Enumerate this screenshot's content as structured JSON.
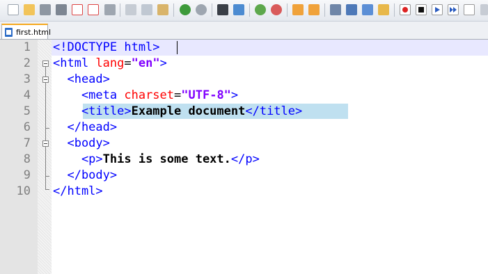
{
  "tabs": [
    {
      "label": "first.html"
    }
  ],
  "editor": {
    "line_numbers": [
      "1",
      "2",
      "3",
      "4",
      "5",
      "6",
      "7",
      "8",
      "9",
      "10"
    ],
    "lines": [
      [
        {
          "t": "tag",
          "v": "<!DOCTYPE html>"
        }
      ],
      [
        {
          "t": "tag",
          "v": "<html "
        },
        {
          "t": "attr",
          "v": "lang"
        },
        {
          "t": "eq",
          "v": "="
        },
        {
          "t": "val",
          "v": "\"en\""
        },
        {
          "t": "tag",
          "v": ">"
        }
      ],
      [
        {
          "t": "tag",
          "v": "  <head>"
        }
      ],
      [
        {
          "t": "tag",
          "v": "    <meta "
        },
        {
          "t": "attr",
          "v": "charset"
        },
        {
          "t": "eq",
          "v": "="
        },
        {
          "t": "val",
          "v": "\"UTF-8\""
        },
        {
          "t": "tag",
          "v": ">"
        }
      ],
      [
        {
          "t": "tag",
          "v": "    <title>"
        },
        {
          "t": "txt",
          "v": "Example document"
        },
        {
          "t": "tag",
          "v": "</title>"
        }
      ],
      [
        {
          "t": "tag",
          "v": "  </head>"
        }
      ],
      [
        {
          "t": "tag",
          "v": "  <body>"
        }
      ],
      [
        {
          "t": "tag",
          "v": "    <p>"
        },
        {
          "t": "txt",
          "v": "This is some text."
        },
        {
          "t": "tag",
          "v": "</p>"
        }
      ],
      [
        {
          "t": "tag",
          "v": "  </body>"
        }
      ],
      [
        {
          "t": "tag",
          "v": "</html>"
        }
      ]
    ]
  },
  "toolbar": {
    "icons": [
      "new-file-icon",
      "open-file-icon",
      "save-icon",
      "save-all-icon",
      "close-icon",
      "close-all-icon",
      "print-icon",
      "cut-icon",
      "copy-icon",
      "paste-icon",
      "undo-icon",
      "redo-icon",
      "find-icon",
      "replace-icon",
      "zoom-in-icon",
      "zoom-out-icon",
      "sync-vertical-icon",
      "sync-horizontal-icon",
      "word-wrap-icon",
      "show-all-chars-icon",
      "indent-guide-icon",
      "doc-map-icon",
      "record-macro-icon",
      "stop-macro-icon",
      "play-macro-icon",
      "run-macro-multiple-icon",
      "save-macro-icon"
    ]
  },
  "colors": {
    "tag": "#0000ff",
    "attr": "#ff0000",
    "value": "#8000ff",
    "text": "#000000",
    "selection": "#bfe0f0",
    "current_line": "#e8e8ff",
    "line_number": "#808080"
  }
}
